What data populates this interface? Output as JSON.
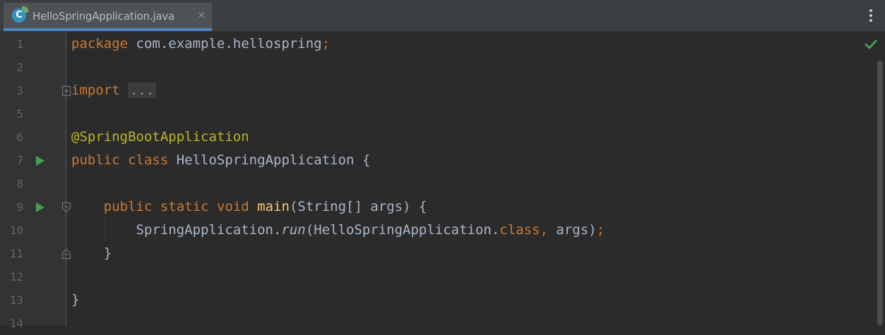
{
  "tab": {
    "filename": "HelloSpringApplication.java",
    "icon": "spring-class-icon",
    "close": "×"
  },
  "menu": {
    "icon": "more-options-icon"
  },
  "inspection": {
    "icon": "no-problems-check-icon",
    "color": "#499c54"
  },
  "colors": {
    "keyword": "#cc7832",
    "annotation": "#bbb529",
    "method": "#ffc66d",
    "text": "#a9b7c6",
    "accent": "#4a88c7"
  },
  "editor": {
    "lines": [
      {
        "number": "1",
        "tokens": [
          {
            "t": "package",
            "c": "kw"
          },
          {
            "t": " com.example.hellospring",
            "c": "plain"
          },
          {
            "t": ";",
            "c": "kw"
          }
        ]
      },
      {
        "number": "2",
        "tokens": []
      },
      {
        "number": "3",
        "tokens": [
          {
            "t": "import",
            "c": "kw"
          },
          {
            "t": " ",
            "c": "plain"
          },
          {
            "t": "...",
            "c": "collapsed"
          }
        ]
      },
      {
        "number": "5",
        "tokens": []
      },
      {
        "number": "6",
        "tokens": [
          {
            "t": "@SpringBootApplication",
            "c": "ann"
          }
        ]
      },
      {
        "number": "7",
        "tokens": [
          {
            "t": "public",
            "c": "kw"
          },
          {
            "t": " ",
            "c": "plain"
          },
          {
            "t": "class",
            "c": "kw"
          },
          {
            "t": " HelloSpringApplication {",
            "c": "plain"
          }
        ]
      },
      {
        "number": "8",
        "tokens": []
      },
      {
        "number": "9",
        "tokens": [
          {
            "t": "    ",
            "c": "plain"
          },
          {
            "t": "public",
            "c": "kw"
          },
          {
            "t": " ",
            "c": "plain"
          },
          {
            "t": "static",
            "c": "kw"
          },
          {
            "t": " ",
            "c": "plain"
          },
          {
            "t": "void",
            "c": "kw"
          },
          {
            "t": " ",
            "c": "plain"
          },
          {
            "t": "main",
            "c": "fn"
          },
          {
            "t": "(String[] args) {",
            "c": "plain"
          }
        ]
      },
      {
        "number": "10",
        "tokens": [
          {
            "t": "        SpringApplication.",
            "c": "plain"
          },
          {
            "t": "run",
            "c": "it"
          },
          {
            "t": "(HelloSpringApplication.",
            "c": "plain"
          },
          {
            "t": "class",
            "c": "kw"
          },
          {
            "t": ", ",
            "c": "kw"
          },
          {
            "t": "args)",
            "c": "plain"
          },
          {
            "t": ";",
            "c": "kw"
          }
        ]
      },
      {
        "number": "11",
        "tokens": [
          {
            "t": "    }",
            "c": "plain"
          }
        ]
      },
      {
        "number": "12",
        "tokens": []
      },
      {
        "number": "13",
        "tokens": [
          {
            "t": "}",
            "c": "plain"
          }
        ]
      },
      {
        "number": "14",
        "tokens": []
      }
    ],
    "run_markers": [
      "7",
      "9"
    ],
    "fold_markers": {
      "3": "fold-expand-icon",
      "9": "fold-collapse-icon",
      "11": "fold-end-icon"
    }
  }
}
